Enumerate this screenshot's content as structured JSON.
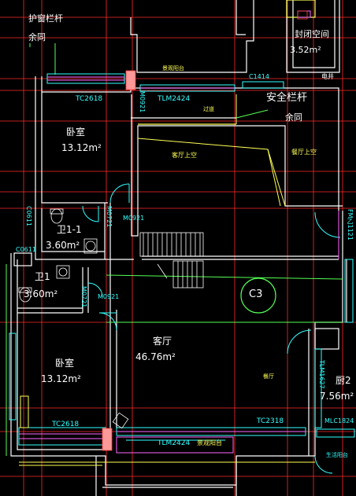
{
  "labels": {
    "guard_rail_window": "护窗栏杆",
    "same_1": "余同",
    "sealed_space": "封闭空间",
    "sealed_area": "3.52m²",
    "scenic_balcony_top": "景观阳台",
    "c1414": "C1414",
    "elevator": "电井",
    "tc2618_top": "TC2618",
    "m0921_a": "M0921",
    "tlm2424_top": "TLM2424",
    "passage": "过道",
    "safety_rail": "安全栏杆",
    "same_2": "余同",
    "bedroom1": "卧室",
    "bedroom1_area": "13.12m²",
    "living_void": "客厅上空",
    "dining_void": "餐厅上空",
    "m0721_a": "M0721",
    "m0921_b": "M0921",
    "c0611_a": "C0611",
    "bath1_1": "卫1-1",
    "bath1_1_area": "3.60m²",
    "c0611_b": "C0611",
    "fm2121": "FM乙1121",
    "bath1": "卫1",
    "bath1_area": "3.60m²",
    "m0721_b": "M0721",
    "m0921_c": "M0921",
    "axis_c3": "C3",
    "living": "客厅",
    "living_area": "46.76m²",
    "bedroom2": "卧室",
    "bedroom2_area": "13.12m²",
    "dining": "餐厅",
    "tlm1627": "TLM1627",
    "kitchen2": "厨2",
    "kitchen2_area": "7.56m²",
    "tc2618_bottom": "TC2618",
    "tc2318": "TC2318",
    "mlc1824": "MLC1824",
    "tlm2424_bottom": "TLM2424",
    "scenic_balcony_bottom": "景观阳台",
    "service_balcony": "生活阳台"
  },
  "colors": {
    "background": "#000000",
    "wall": "#ffffff",
    "grid": "#ff2a2a",
    "window": "#33ffff",
    "window_line": "#ff66ff",
    "door": "#33ffff",
    "rail": "#55ff55",
    "label_yellow": "#ffff55",
    "column": "#ff9999"
  },
  "icons": {
    "toilet": "toilet-icon",
    "basin": "basin-icon",
    "stairs": "staircase-icon",
    "axis_marker": "axis-circle-icon"
  }
}
